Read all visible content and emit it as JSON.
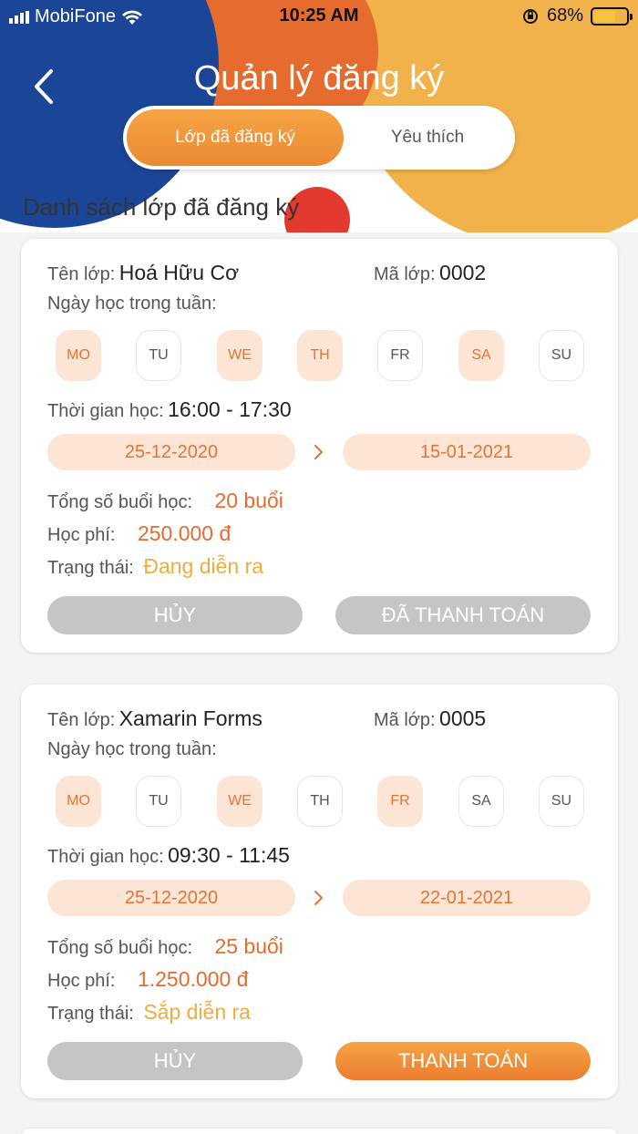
{
  "status_bar": {
    "carrier": "MobiFone",
    "time": "10:25 AM",
    "battery": "68%",
    "battery_level": 0.68
  },
  "header": {
    "title": "Quản lý đăng ký"
  },
  "tabs": [
    {
      "label": "Lớp đã đăng ký",
      "active": true
    },
    {
      "label": "Yêu thích",
      "active": false
    }
  ],
  "list_title": "Danh sách lớp đã đăng ký",
  "labels": {
    "class_name": "Tên lớp:",
    "class_code": "Mã lớp:",
    "days": "Ngày học trong tuần:",
    "time": "Thời gian học:",
    "total": "Tổng số buổi học:",
    "fee": "Học phí:",
    "status": "Trạng thái:"
  },
  "day_names": [
    "MO",
    "TU",
    "WE",
    "TH",
    "FR",
    "SA",
    "SU"
  ],
  "classes": [
    {
      "name": "Hoá Hữu Cơ",
      "code": "0002",
      "days_active": [
        true,
        false,
        true,
        true,
        false,
        true,
        false
      ],
      "time": "16:00 - 17:30",
      "start_date": "25-12-2020",
      "end_date": "15-01-2021",
      "total": "20 buổi",
      "fee": "250.000 đ",
      "status": "Đang diễn ra",
      "btn_cancel": "HỦY",
      "btn_pay": "ĐÃ THANH TOÁN",
      "paid": true
    },
    {
      "name": "Xamarin Forms",
      "code": "0005",
      "days_active": [
        true,
        false,
        true,
        false,
        true,
        false,
        false
      ],
      "time": "09:30 - 11:45",
      "start_date": "25-12-2020",
      "end_date": "22-01-2021",
      "total": "25 buổi",
      "fee": "1.250.000 đ",
      "status": "Sắp diễn ra",
      "btn_cancel": "HỦY",
      "btn_pay": "THANH TOÁN",
      "paid": false
    }
  ],
  "colors": {
    "accent": "#EC8A34",
    "primary_blue": "#1B4596",
    "yellow": "#F2B24B",
    "red": "#E33A2F"
  }
}
